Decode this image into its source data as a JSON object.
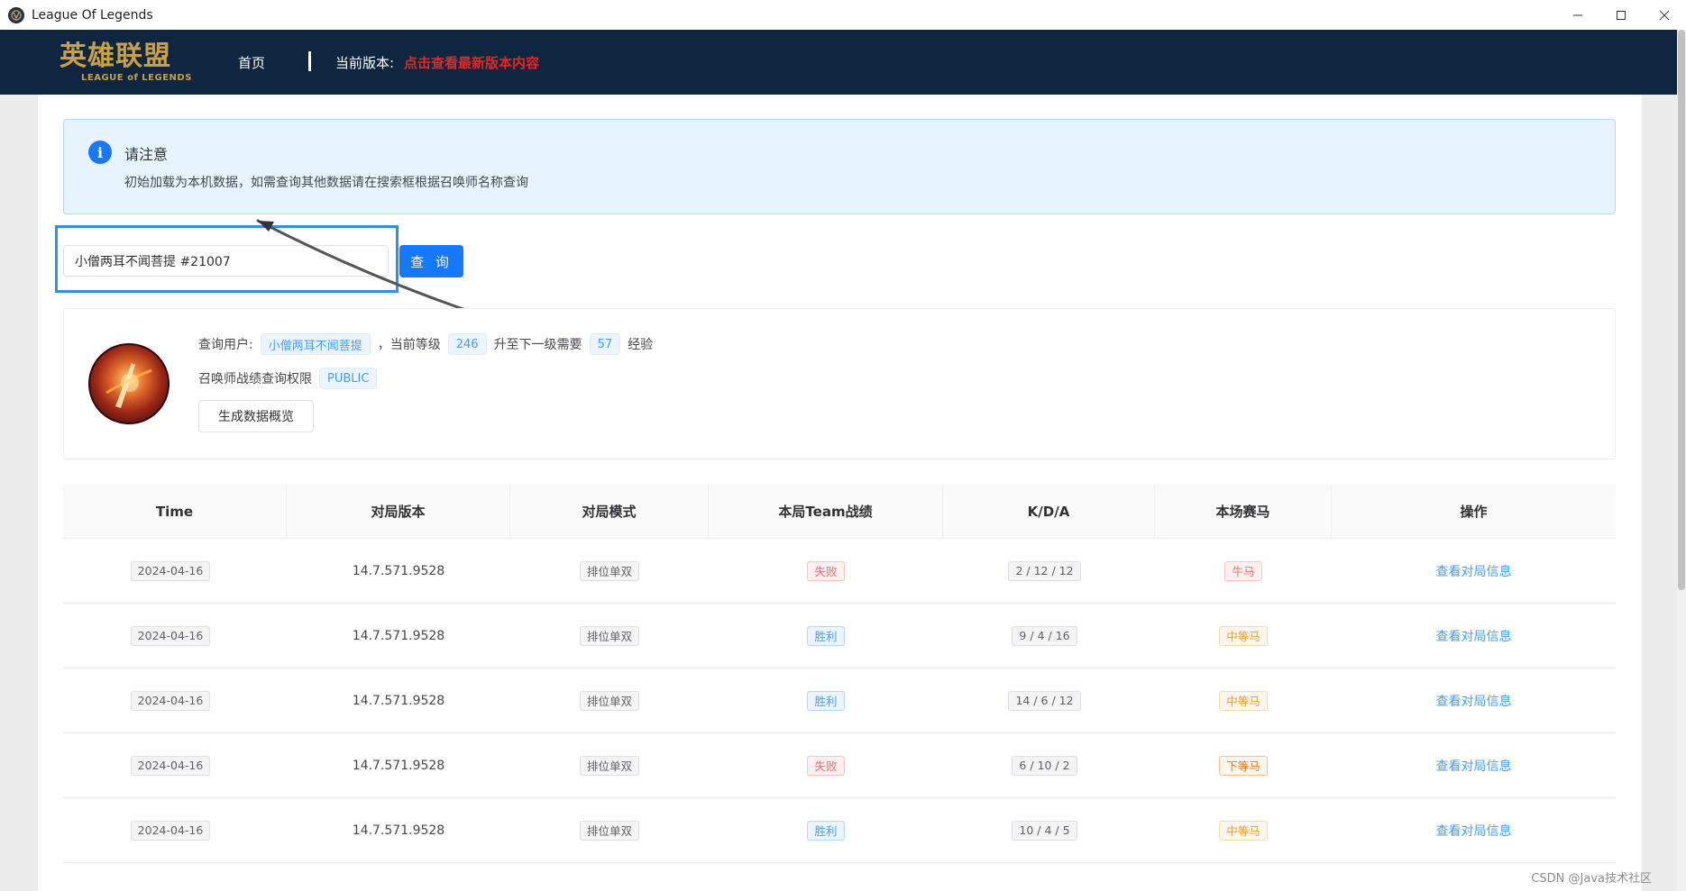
{
  "window": {
    "title": "League Of Legends"
  },
  "header": {
    "logo_cn": "英雄联盟",
    "logo_en": "LEAGUE of LEGENDS",
    "home_label": "首页",
    "version_label": "当前版本:",
    "version_link": "点击查看最新版本内容"
  },
  "alert": {
    "title": "请注意",
    "description": "初始加载为本机数据，如需查询其他数据请在搜索框根据召唤师名称查询"
  },
  "search": {
    "value": "小僧两耳不闻菩提 #21007",
    "button_label": "查 询"
  },
  "profile": {
    "query_user_label": "查询用户:",
    "username": "小僧两耳不闻菩提",
    "level_label": "，当前等级",
    "level": "246",
    "next_level_label": "升至下一级需要",
    "exp_needed": "57",
    "exp_label": "经验",
    "privacy_label": "召唤师战绩查询权限",
    "privacy_value": "PUBLIC",
    "generate_button": "生成数据概览"
  },
  "table": {
    "headers": [
      "Time",
      "对局版本",
      "对局模式",
      "本局Team战绩",
      "K/D/A",
      "本场赛马",
      "操作"
    ],
    "rows": [
      {
        "date": "2024-04-16",
        "version": "14.7.571.9528",
        "mode": "排位单双",
        "result": "失败",
        "kda": "2 / 12 / 12",
        "rank": "牛马",
        "action": "查看对局信息"
      },
      {
        "date": "2024-04-16",
        "version": "14.7.571.9528",
        "mode": "排位单双",
        "result": "胜利",
        "kda": "9 / 4 / 16",
        "rank": "中等马",
        "action": "查看对局信息"
      },
      {
        "date": "2024-04-16",
        "version": "14.7.571.9528",
        "mode": "排位单双",
        "result": "胜利",
        "kda": "14 / 6 / 12",
        "rank": "中等马",
        "action": "查看对局信息"
      },
      {
        "date": "2024-04-16",
        "version": "14.7.571.9528",
        "mode": "排位单双",
        "result": "失败",
        "kda": "6 / 10 / 2",
        "rank": "下等马",
        "action": "查看对局信息"
      },
      {
        "date": "2024-04-16",
        "version": "14.7.571.9528",
        "mode": "排位单双",
        "result": "胜利",
        "kda": "10 / 4 / 5",
        "rank": "中等马",
        "action": "查看对局信息"
      }
    ]
  },
  "watermark": "CSDN @Java技术社区",
  "colors": {
    "header_bg": "#0f2640",
    "logo_gold": "#c9a045",
    "accent": "#1677ff",
    "version_link": "#e8261f"
  }
}
